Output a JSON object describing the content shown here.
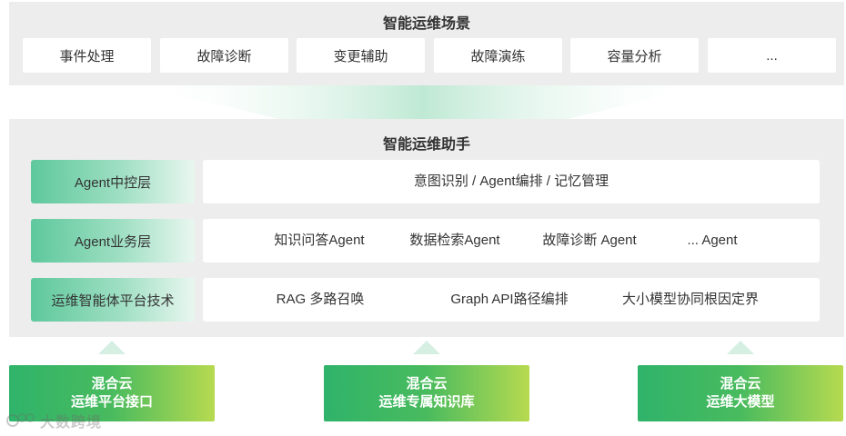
{
  "scenarios": {
    "title": "智能运维场景",
    "items": [
      "事件处理",
      "故障诊断",
      "变更辅助",
      "故障演练",
      "容量分析",
      "..."
    ]
  },
  "assistant": {
    "title": "智能运维助手",
    "layers": [
      {
        "label": "Agent中控层",
        "items": [
          "意图识别 / Agent编排 / 记忆管理"
        ]
      },
      {
        "label": "Agent业务层",
        "items": [
          "知识问答Agent",
          "数据检索Agent",
          "故障诊断 Agent",
          "... Agent"
        ]
      },
      {
        "label": "运维智能体平台技术",
        "items": [
          "RAG 多路召唤",
          "Graph API路径编排",
          "大小模型协同根因定界"
        ]
      }
    ]
  },
  "foundations": [
    {
      "line1": "混合云",
      "line2": "运维平台接口"
    },
    {
      "line1": "混合云",
      "line2": "运维专属知识库"
    },
    {
      "line1": "混合云",
      "line2": "运维大模型"
    }
  ],
  "watermark": {
    "text": "大数跨境"
  },
  "colors": {
    "panel_bg": "#ededed",
    "layer_green": "#5ec89c",
    "base_green": "#2fb36a",
    "base_lime": "#b7da50"
  }
}
